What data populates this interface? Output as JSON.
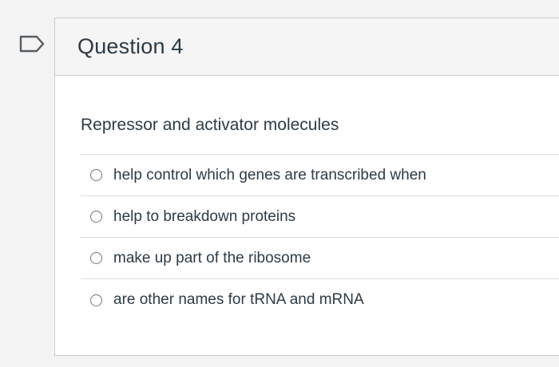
{
  "question": {
    "title": "Question 4",
    "text": "Repressor and activator molecules"
  },
  "answers": [
    {
      "label": "help control which genes are transcribed when",
      "selected": false
    },
    {
      "label": "help to breakdown proteins",
      "selected": false
    },
    {
      "label": "make up part of the ribosome",
      "selected": false
    },
    {
      "label": "are other names for tRNA and mRNA",
      "selected": false
    }
  ],
  "icons": {
    "flag": "flag-question-icon"
  },
  "colors": {
    "text": "#2d3b45",
    "border": "#c7cdd1",
    "header_bg": "#f5f5f5",
    "page_bg": "#f3f3f3"
  }
}
